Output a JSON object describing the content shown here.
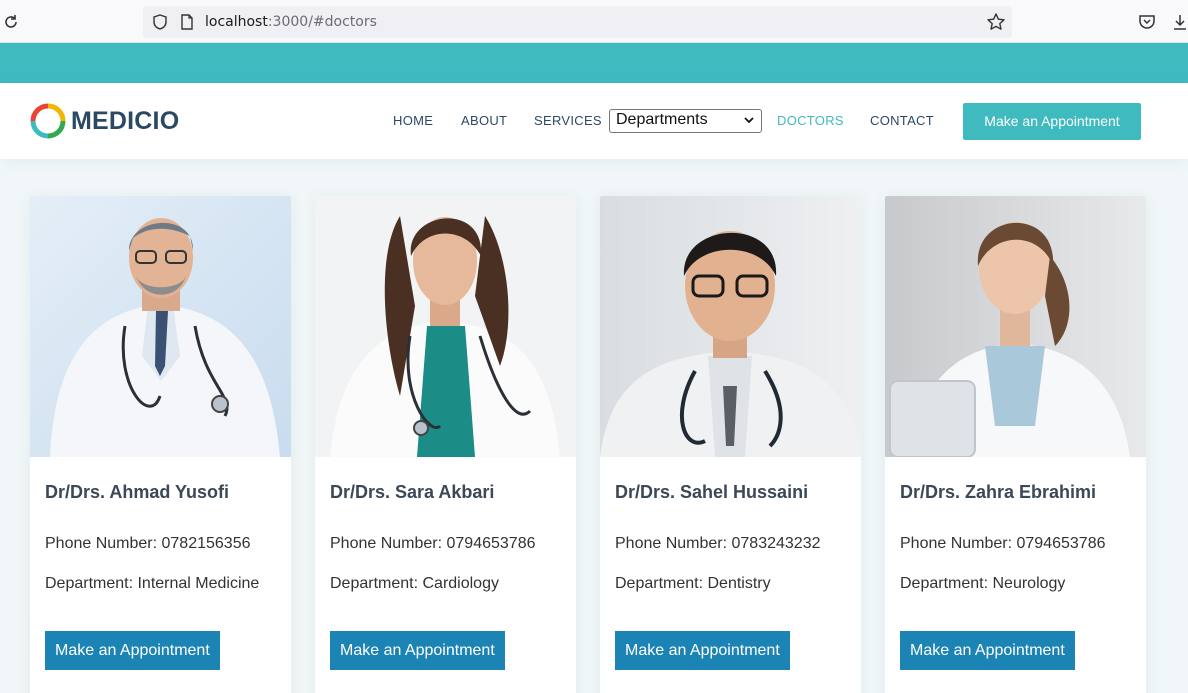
{
  "browser": {
    "url_host": "localhost",
    "url_rest": ":3000/#doctors"
  },
  "brand": {
    "name": "MEDICIO"
  },
  "nav": {
    "home": "HOME",
    "about": "ABOUT",
    "services": "SERVICES",
    "departments_select": "Departments",
    "doctors": "DOCTORS",
    "contact": "CONTACT",
    "cta": "Make an Appointment"
  },
  "colors": {
    "accent": "#3fbbc0",
    "button": "#1c84b4",
    "text": "#2c4964"
  },
  "doctors": [
    {
      "name": "Dr/Drs. Ahmad Yusofi",
      "phone": "Phone Number: 0782156356",
      "department": "Department: Internal Medicine",
      "button": "Make an Appointment"
    },
    {
      "name": "Dr/Drs. Sara Akbari",
      "phone": "Phone Number: 0794653786",
      "department": "Department: Cardiology",
      "button": "Make an Appointment"
    },
    {
      "name": "Dr/Drs. Sahel Hussaini",
      "phone": "Phone Number: 0783243232",
      "department": "Department: Dentistry",
      "button": "Make an Appointment"
    },
    {
      "name": "Dr/Drs. Zahra Ebrahimi",
      "phone": "Phone Number: 0794653786",
      "department": "Department: Neurology",
      "button": "Make an Appointment"
    }
  ]
}
